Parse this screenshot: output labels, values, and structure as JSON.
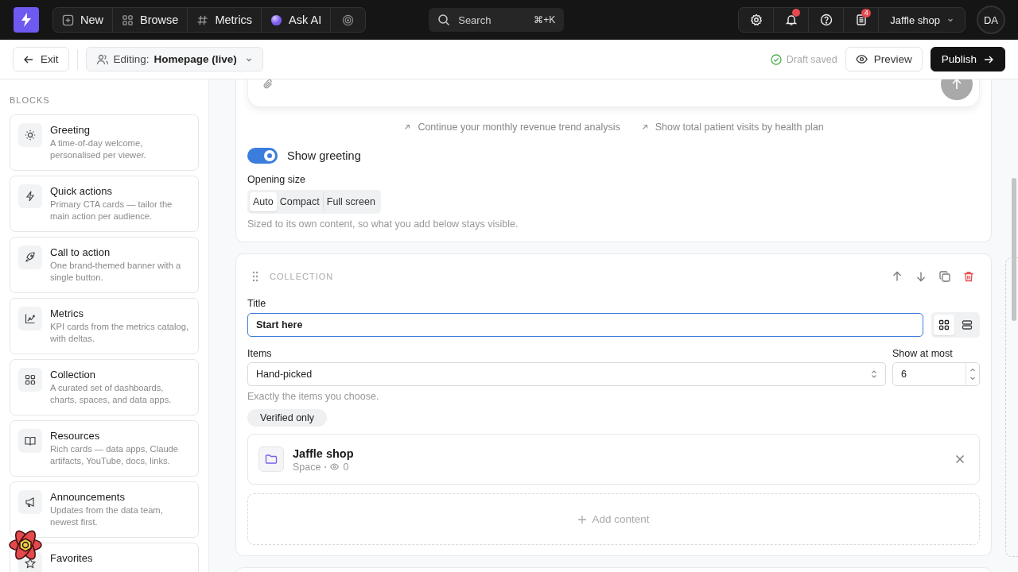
{
  "topbar": {
    "nav": [
      {
        "kind": "new",
        "label": "New"
      },
      {
        "kind": "browse",
        "label": "Browse"
      },
      {
        "kind": "metrics",
        "label": "Metrics"
      },
      {
        "kind": "ai",
        "label": "Ask AI"
      },
      {
        "kind": "target"
      }
    ],
    "search": {
      "placeholder": "Search",
      "shortcut": "⌘+K"
    },
    "tools": [
      {
        "kind": "settings"
      },
      {
        "kind": "bell",
        "unread": true
      },
      {
        "kind": "help"
      },
      {
        "kind": "docs",
        "badge": "4"
      }
    ],
    "workspace": "Jaffle shop",
    "avatar": "DA"
  },
  "editbar": {
    "exit": "Exit",
    "editing_label": "Editing:",
    "page": "Homepage (live)",
    "status": "Draft saved",
    "preview": "Preview",
    "publish": "Publish"
  },
  "sidebar": {
    "heading": "BLOCKS",
    "blocks": [
      {
        "kind": "sun",
        "title": "Greeting",
        "description": "A time-of-day welcome, personalised per viewer."
      },
      {
        "kind": "bolt",
        "title": "Quick actions",
        "description": "Primary CTA cards — tailor the main action per audience."
      },
      {
        "kind": "rocket",
        "title": "Call to action",
        "description": "One brand-themed banner with a single button."
      },
      {
        "kind": "chart",
        "title": "Metrics",
        "description": "KPI cards from the metrics catalog, with deltas."
      },
      {
        "kind": "grid",
        "title": "Collection",
        "description": "A curated set of dashboards, charts, spaces, and data apps."
      },
      {
        "kind": "book",
        "title": "Resources",
        "description": "Rich cards — data apps, Claude artifacts, YouTube, docs, links."
      },
      {
        "kind": "megaphone",
        "title": "Announcements",
        "description": "Updates from the data team, newest first."
      },
      {
        "kind": "star",
        "title": "Favorites"
      }
    ]
  },
  "greeting": {
    "suggestions": [
      "Continue your monthly revenue trend analysis",
      "Show total patient visits by health plan"
    ],
    "show_greeting": {
      "label": "Show greeting",
      "on": true
    },
    "opening_size": {
      "label": "Opening size",
      "options": [
        {
          "label": "Auto",
          "selected": true
        },
        {
          "label": "Compact",
          "selected": false
        },
        {
          "label": "Full screen",
          "selected": false
        }
      ],
      "hint": "Sized to its own content, so what you add below stays visible."
    }
  },
  "collection": {
    "heading": "COLLECTION",
    "title_field": {
      "label": "Title",
      "value": "Start here"
    },
    "layouts": [
      {
        "kind": "grid",
        "selected": true
      },
      {
        "kind": "list",
        "selected": false
      }
    ],
    "items_field": {
      "label": "Items",
      "value": "Hand-picked"
    },
    "show_at_most": {
      "label": "Show at most",
      "value": "6"
    },
    "hint": "Exactly the items you choose.",
    "filter": "Verified only",
    "entries": [
      {
        "name": "Jaffle shop",
        "type": "Space",
        "views": "0"
      }
    ],
    "add": "Add content"
  }
}
